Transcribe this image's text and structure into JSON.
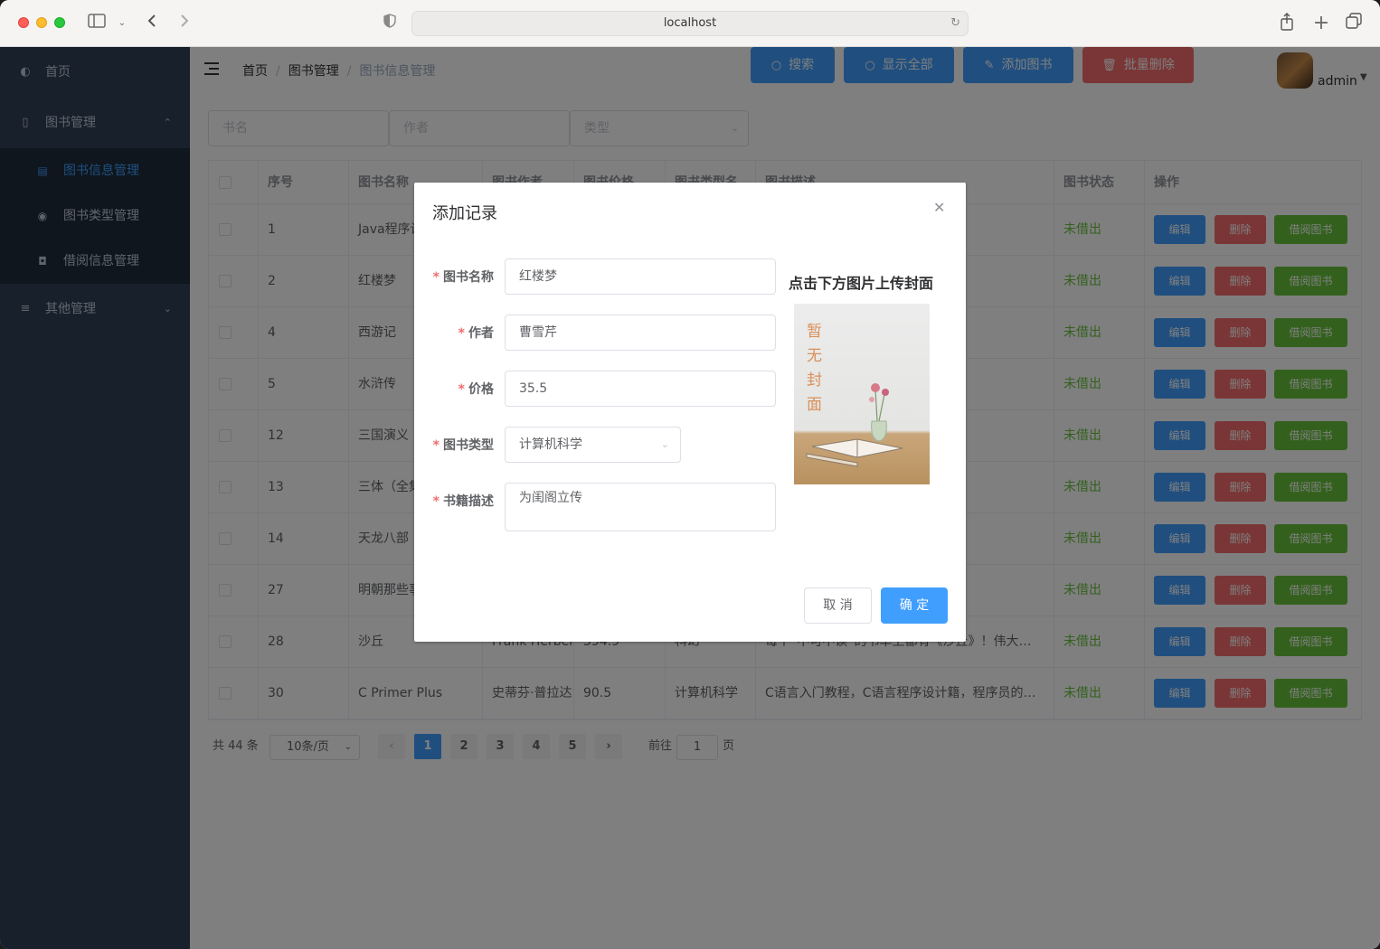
{
  "browser": {
    "url": "localhost"
  },
  "sidebar": {
    "home": "首页",
    "book_mgmt": "图书管理",
    "sub": [
      "图书信息管理",
      "图书类型管理",
      "借阅信息管理"
    ],
    "other": "其他管理"
  },
  "breadcrumb": {
    "home": "首页",
    "level1": "图书管理",
    "current": "图书信息管理"
  },
  "user": {
    "name": "admin"
  },
  "filters": {
    "name_placeholder": "书名",
    "author_placeholder": "作者",
    "type_placeholder": "类型",
    "search": "搜索",
    "show_all": "显示全部",
    "add": "添加图书",
    "batch_delete": "批量删除"
  },
  "table": {
    "headers": [
      "序号",
      "图书名称",
      "图书作者",
      "图书价格",
      "图书类型名",
      "图书描述",
      "图书状态",
      "操作"
    ],
    "row_buttons": {
      "edit": "编辑",
      "delete": "删除",
      "borrow": "借阅图书"
    },
    "rows": [
      {
        "id": "1",
        "name": "Java程序设计",
        "author": "",
        "price": "",
        "type": "",
        "desc": "高等院校相…",
        "status": "未借出"
      },
      {
        "id": "2",
        "name": "红楼梦",
        "author": "",
        "price": "",
        "type": "",
        "desc": "篇小说。以…",
        "status": "未借出"
      },
      {
        "id": "4",
        "name": "西游记",
        "author": "",
        "price": "",
        "type": "",
        "desc": "唐僧西天取…",
        "status": "未借出"
      },
      {
        "id": "5",
        "name": "水浒传",
        "author": "",
        "price": "",
        "type": "",
        "desc": "义为题材的…",
        "status": "未借出"
      },
      {
        "id": "12",
        "name": "三国演义",
        "author": "",
        "price": "",
        "type": "",
        "desc": "、《三国志…",
        "status": "未借出"
      },
      {
        "id": "13",
        "name": "三体（全集）",
        "author": "",
        "price": "",
        "type": "",
        "desc": "森林》《三…",
        "status": "未借出"
      },
      {
        "id": "14",
        "name": "天龙八部",
        "author": "",
        "price": "",
        "type": "",
        "desc": "，与《射雕…",
        "status": "未借出"
      },
      {
        "id": "27",
        "name": "明朝那些事儿",
        "author": "",
        "price": "",
        "type": "",
        "desc": "畅销3000万…",
        "status": "未借出"
      },
      {
        "id": "28",
        "name": "沙丘",
        "author": "Frank Herbert",
        "price": "394.9",
        "type": "科幻",
        "desc": "每个“不可不读”的书单上都有《沙丘》！伟大…",
        "status": "未借出"
      },
      {
        "id": "30",
        "name": "C Primer Plus",
        "author": "史蒂芬·普拉达",
        "price": "90.5",
        "type": "计算机科学",
        "desc": "C语言入门教程，C语言程序设计籍，程序员的…",
        "status": "未借出"
      }
    ]
  },
  "pagination": {
    "total": "共 44 条",
    "page_size": "10条/页",
    "pages": [
      "1",
      "2",
      "3",
      "4",
      "5"
    ],
    "current": "1",
    "goto_prefix": "前往",
    "goto_value": "1",
    "goto_suffix": "页"
  },
  "dialog": {
    "title": "添加记录",
    "labels": {
      "name": "图书名称",
      "author": "作者",
      "price": "价格",
      "type": "图书类型",
      "desc": "书籍描述"
    },
    "values": {
      "name": "红楼梦",
      "author": "曹雪芹",
      "price": "35.5",
      "type": "计算机科学",
      "desc": "为闺阁立传"
    },
    "upload_title": "点击下方图片上传封面",
    "cover_text": "暂无封面",
    "cancel": "取 消",
    "confirm": "确 定"
  }
}
